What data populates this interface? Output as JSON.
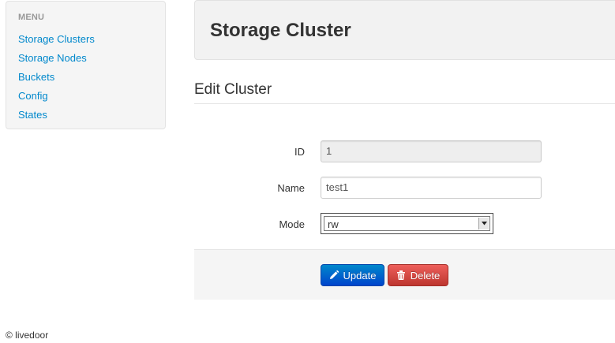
{
  "sidebar": {
    "header": "MENU",
    "items": [
      {
        "label": "Storage Clusters"
      },
      {
        "label": "Storage Nodes"
      },
      {
        "label": "Buckets"
      },
      {
        "label": "Config"
      },
      {
        "label": "States"
      }
    ]
  },
  "header": {
    "title": "Storage Cluster"
  },
  "form": {
    "legend": "Edit Cluster",
    "id_label": "ID",
    "id_value": "1",
    "name_label": "Name",
    "name_value": "test1",
    "mode_label": "Mode",
    "mode_value": "rw"
  },
  "actions": {
    "update_label": "Update",
    "update_icon": "pencil-icon",
    "delete_label": "Delete",
    "delete_icon": "trash-icon"
  },
  "footer": {
    "text": "© livedoor"
  },
  "colors": {
    "link": "#0088cc",
    "primary": "#0066cc",
    "danger": "#da4f49"
  }
}
